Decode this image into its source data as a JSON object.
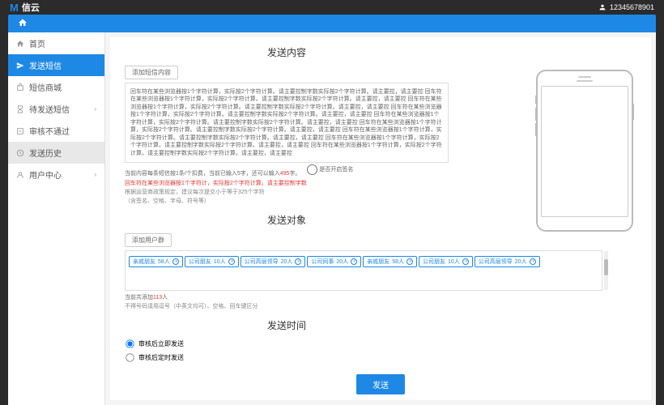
{
  "brand": {
    "prefix": "M",
    "name": "信云"
  },
  "user": {
    "id": "12345678901"
  },
  "sidebar": {
    "items": [
      {
        "label": "首页"
      },
      {
        "label": "发送短信"
      },
      {
        "label": "短信商城"
      },
      {
        "label": "待发送短信"
      },
      {
        "label": "审核不通过"
      },
      {
        "label": "发送历史"
      },
      {
        "label": "用户中心"
      }
    ]
  },
  "sections": {
    "content_title": "发送内容",
    "recipients_title": "发送对象",
    "time_title": "发送时间"
  },
  "buttons": {
    "add_template": "添加短信内容",
    "add_group": "添加用户群",
    "send": "发送"
  },
  "content_text": "回车符在某些浏览器按1个字符计算，实际按2个字符计算。请主要控制字数实际按2个字符计算。请主要控，请主要控 回车符在某些浏览器按1个字符计算，实际按2个字符计算。请主要控制字数实际按2个字符计算。请主要控，请主要控 回车符在某些浏览器按1个字符计算，实际按2个字符计算。请主要控制字数实际按2个字符计算。请主要控，请主要控 回车符在某些浏览器按1个字符计算，实际按2个字符计算。请主要控制字数实际按2个字符计算。请主要控，请主要控 回车符在某些浏览器按1个字符计算，实际按2个字符计算。请主要控制字数实际按2个字符计算。请主要控，请主要控 回车符在某些浏览器按1个字符计算，实际按2个字符计算。请主要控制字数实际按2个字符计算。请主要控，请主要控 回车符在某些浏览器按1个字符计算，实际按2个字符计算。请主要控制字数实际按2个字符计算。请主要控，请主要控 回车符在某些浏览器按1个字符计算，实际按2个字符计算。请主要控制字数实际按2个字符计算。请主要控，请主要控 回车符在某些浏览器按1个字符计算，实际按2个字符计算。请主要控制字数实际按2个字符计算。请主要控，请主要控",
  "hints": {
    "count_prefix": "当前内容每条短信按1条/个扣费，当前已输入5字，还可以输入",
    "count_num": "495",
    "count_suffix": "字。",
    "signature_checkbox": "是否开启签名",
    "red_line": "回车符在某些浏览器按1个字符计，实际按2个字符计算。请主要控制字数",
    "policy_1": "根据运营商政策规定，建议每次提交小于等于325个字符",
    "policy_2": "（含签名、空格、字母、符号等）",
    "recipients_prefix": "当前共添加",
    "recipients_num": "113",
    "recipients_suffix": "人",
    "recipients_tip": "不得号码请用逗号（中英文均可）、空格、回车键区分"
  },
  "tags": [
    {
      "name": "亲戚朋友",
      "count": "58人"
    },
    {
      "name": "公司朋友",
      "count": "10人"
    },
    {
      "name": "公司高层领导",
      "count": "20人"
    },
    {
      "name": "公司同事",
      "count": "20人"
    },
    {
      "name": "亲戚朋友",
      "count": "58人"
    },
    {
      "name": "公司朋友",
      "count": "10人"
    },
    {
      "name": "公司高层领导",
      "count": "20人"
    }
  ],
  "timing": {
    "opt1": "审核后立即发送",
    "opt2": "审核后定时发送"
  }
}
